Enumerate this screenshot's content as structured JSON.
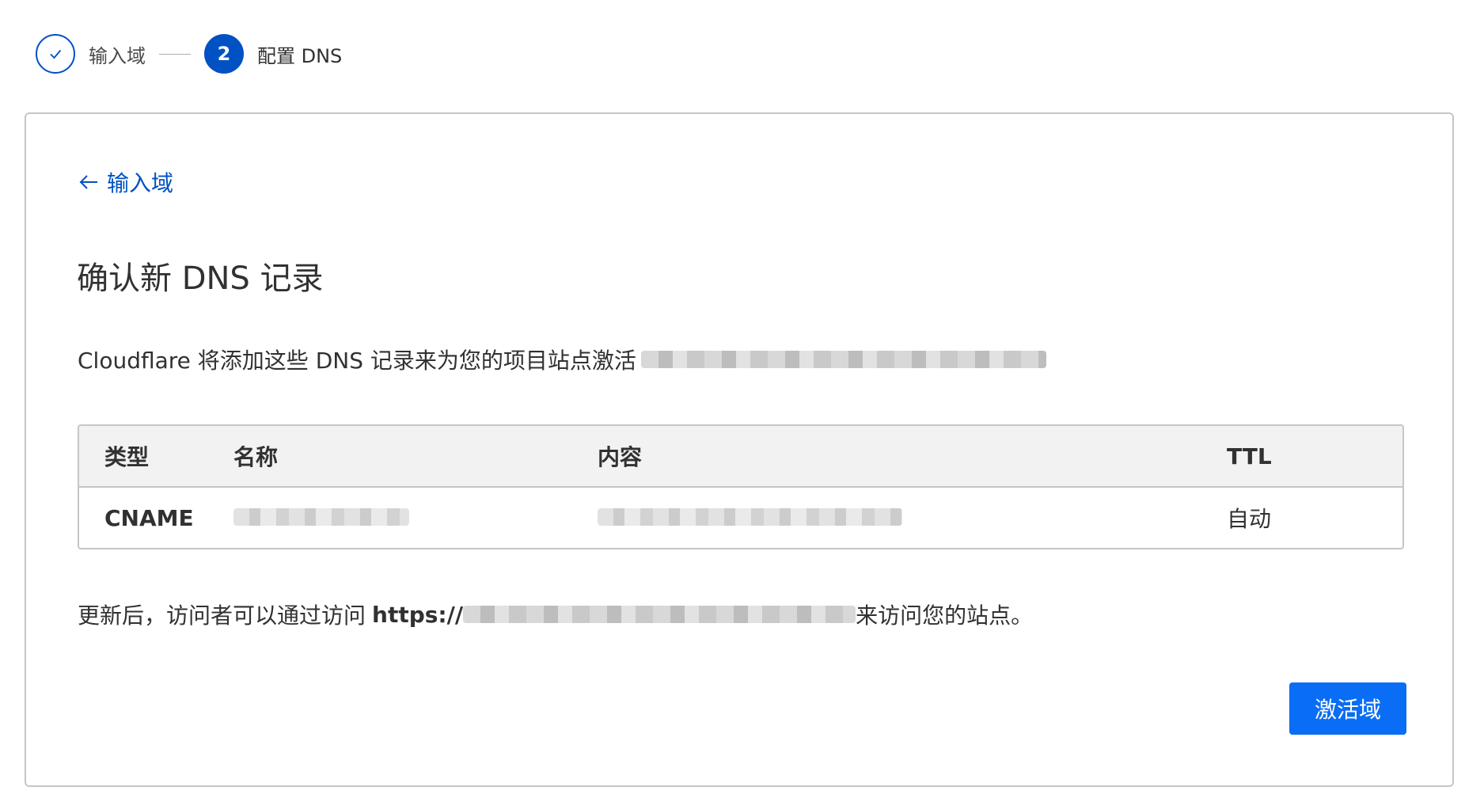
{
  "stepper": {
    "step1": {
      "label": "输入域",
      "status": "done"
    },
    "step2": {
      "number": "2",
      "label": "配置 DNS",
      "status": "active"
    }
  },
  "back_link": {
    "label": "输入域"
  },
  "title": "确认新 DNS 记录",
  "description": {
    "text": "Cloudflare 将添加这些 DNS 记录来为您的项目站点激活"
  },
  "table": {
    "headers": {
      "type": "类型",
      "name": "名称",
      "content": "内容",
      "ttl": "TTL"
    },
    "rows": [
      {
        "type": "CNAME",
        "ttl": "自动"
      }
    ]
  },
  "footer": {
    "prefix": "更新后，访问者可以通过访问",
    "url_prefix": "https://",
    "suffix": "来访问您的站点。"
  },
  "activate_button": {
    "label": "激活域"
  },
  "colors": {
    "accent": "#0051c3",
    "button": "#0a6df6",
    "border": "#c6c6c6",
    "header_bg": "#f2f2f2"
  }
}
